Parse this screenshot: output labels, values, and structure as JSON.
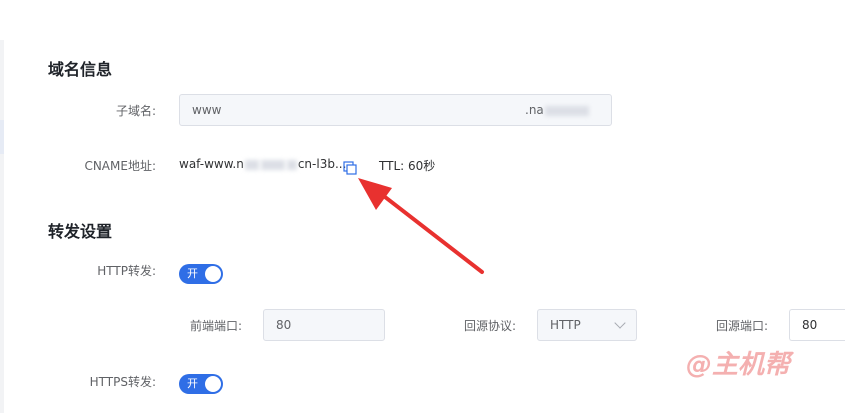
{
  "domain_info": {
    "title": "域名信息",
    "subdomain_label": "子域名:",
    "subdomain_value": "www",
    "subdomain_suffix": ".na",
    "cname_label": "CNAME地址:",
    "cname_prefix": "waf-www.n",
    "cname_suffix": "cn-l3b...",
    "ttl": "TTL:  60秒"
  },
  "forwarding": {
    "title": "转发设置",
    "http_label": "HTTP转发:",
    "http_switch_text": "开",
    "frontend_port_label": "前端端口:",
    "frontend_port_value": "80",
    "origin_protocol_label": "回源协议:",
    "origin_protocol_value": "HTTP",
    "origin_port_label": "回源端口:",
    "origin_port_value": "80",
    "https_label": "HTTPS转发:",
    "https_switch_text": "开"
  },
  "watermark": "@主机帮",
  "colors": {
    "accent": "#2f6ee6",
    "arrow": "#e8312f"
  },
  "icons": {
    "copy": "copy-icon"
  }
}
